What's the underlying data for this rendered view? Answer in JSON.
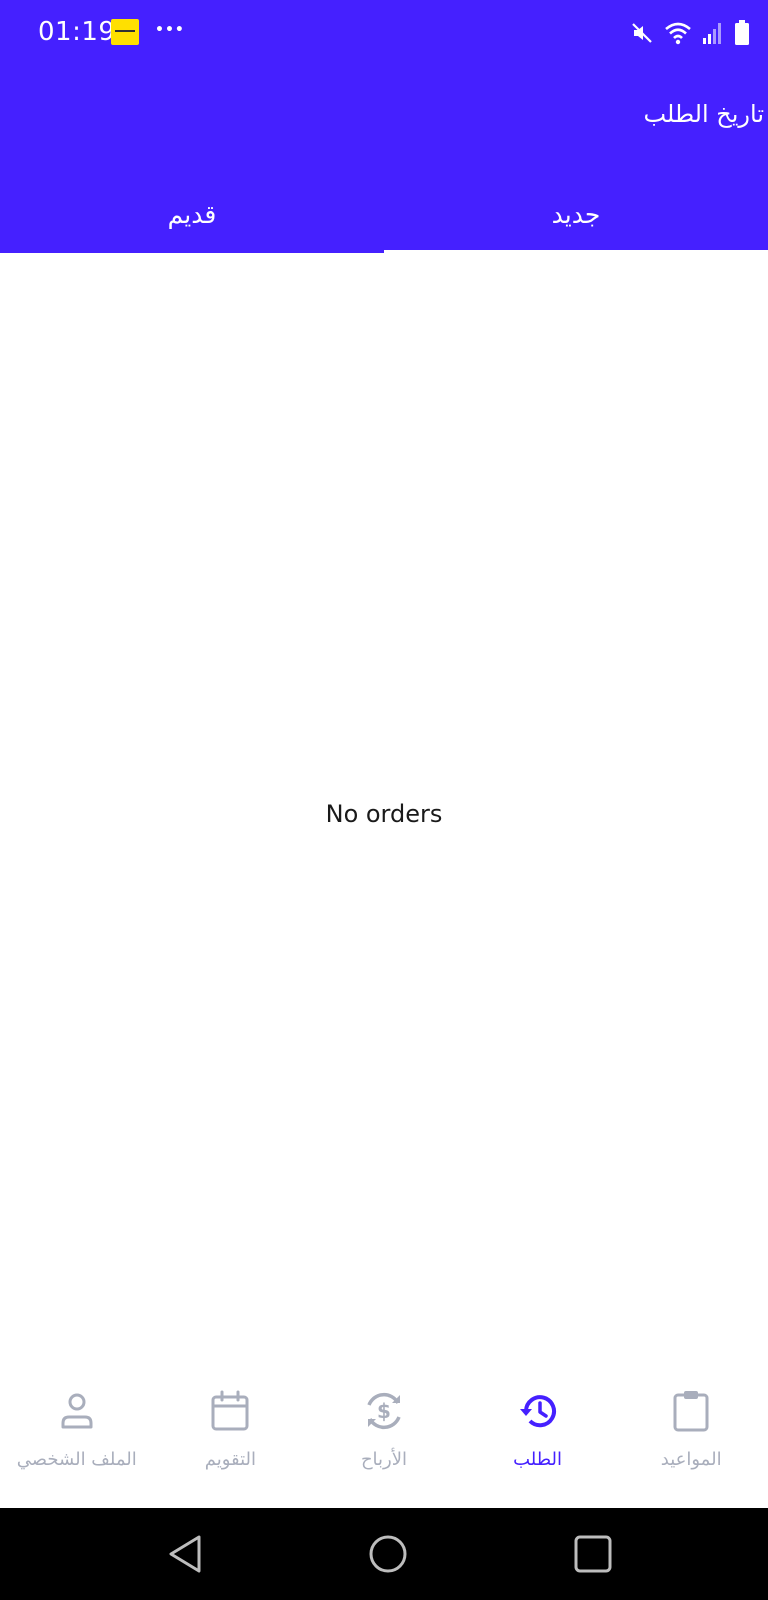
{
  "status_bar": {
    "time": "01:19",
    "app_notification_icon": "yellow-app-icon",
    "more_indicator": "•••",
    "right_icons": [
      "mute-icon",
      "wifi-icon",
      "signal-icon",
      "battery-icon"
    ]
  },
  "header": {
    "title": "تاريخ الطلب",
    "background_color": "#4520FF"
  },
  "tabs": [
    {
      "label": "قديم",
      "active": false
    },
    {
      "label": "جديد",
      "active": true
    }
  ],
  "main": {
    "empty_message": "No orders"
  },
  "bottom_nav": {
    "items": [
      {
        "label": "الملف الشخصي",
        "icon": "person-icon",
        "active": false
      },
      {
        "label": "التقويم",
        "icon": "calendar-icon",
        "active": false
      },
      {
        "label": "الأرباح",
        "icon": "dollar-sync-icon",
        "active": false
      },
      {
        "label": "الطلب",
        "icon": "history-icon",
        "active": true
      },
      {
        "label": "المواعيد",
        "icon": "clipboard-icon",
        "active": false
      }
    ],
    "active_color": "#4520FF",
    "inactive_color": "#A9AEBC"
  },
  "system_nav": {
    "buttons": [
      "back-icon",
      "home-icon",
      "recents-icon"
    ]
  }
}
